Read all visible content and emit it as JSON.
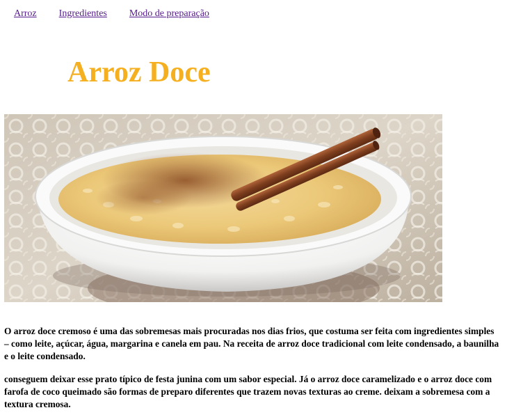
{
  "nav": {
    "items": [
      {
        "label": "Arroz"
      },
      {
        "label": "Ingredientes"
      },
      {
        "label": "Modo de preparação"
      }
    ],
    "link_color": "#551a8b"
  },
  "title": {
    "text": "Arroz Doce",
    "color": "#f5b021"
  },
  "hero_image": {
    "subject": "bowl of creamy arroz doce with cinnamon sticks on lace tablecloth"
  },
  "paragraphs": [
    "O arroz doce cremoso é uma das sobremesas mais procuradas nos dias frios, que costuma ser feita com ingredientes simples – como leite, açúcar, água, margarina e canela em pau. Na receita de arroz doce tradicional com leite condensado, a baunilha e o leite condensado.",
    "conseguem deixar esse prato típico de festa junina com um sabor especial. Já o arroz doce caramelizado e o arroz doce com farofa de coco queimado são formas de preparo diferentes que trazem novas texturas ao creme. deixam a sobremesa com a textura cremosa."
  ]
}
